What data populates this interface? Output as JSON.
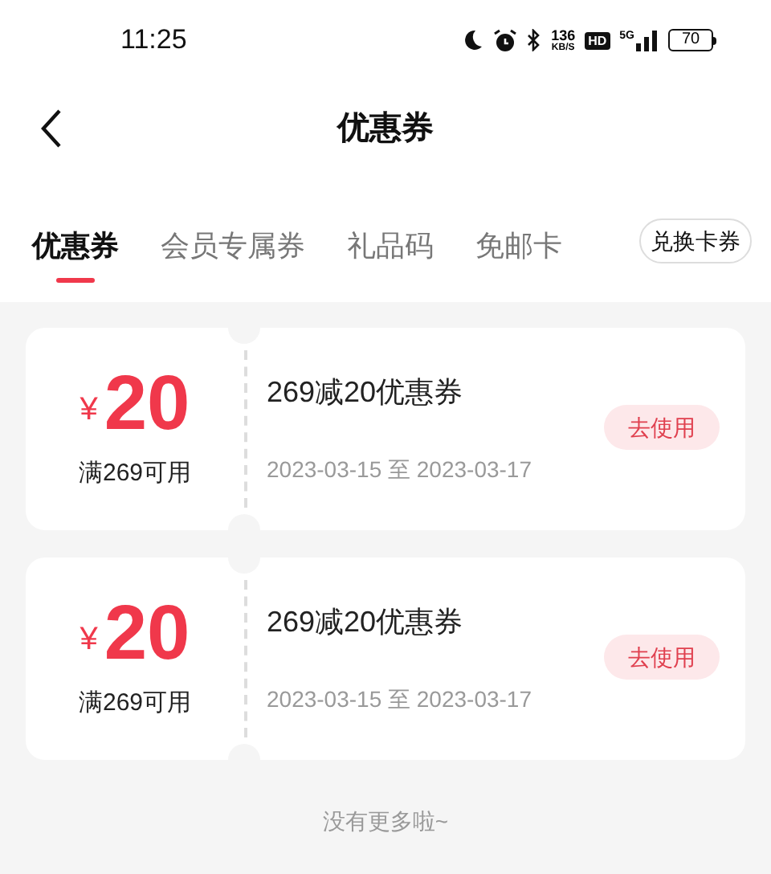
{
  "status_bar": {
    "time": "11:25",
    "net_speed": "136",
    "net_unit": "KB/S",
    "hd": "HD",
    "network": "5G",
    "battery": "70"
  },
  "header": {
    "title": "优惠券"
  },
  "tabs": [
    {
      "label": "优惠券",
      "selected": true
    },
    {
      "label": "会员专属券",
      "selected": false
    },
    {
      "label": "礼品码",
      "selected": false
    },
    {
      "label": "免邮卡",
      "selected": false
    }
  ],
  "exchange_button": "兑换卡券",
  "coupons": [
    {
      "currency": "¥",
      "amount": "20",
      "condition": "满269可用",
      "title": "269减20优惠券",
      "validity": "2023-03-15 至 2023-03-17",
      "action": "去使用"
    },
    {
      "currency": "¥",
      "amount": "20",
      "condition": "满269可用",
      "title": "269减20优惠券",
      "validity": "2023-03-15 至 2023-03-17",
      "action": "去使用"
    }
  ],
  "footer": "没有更多啦~"
}
